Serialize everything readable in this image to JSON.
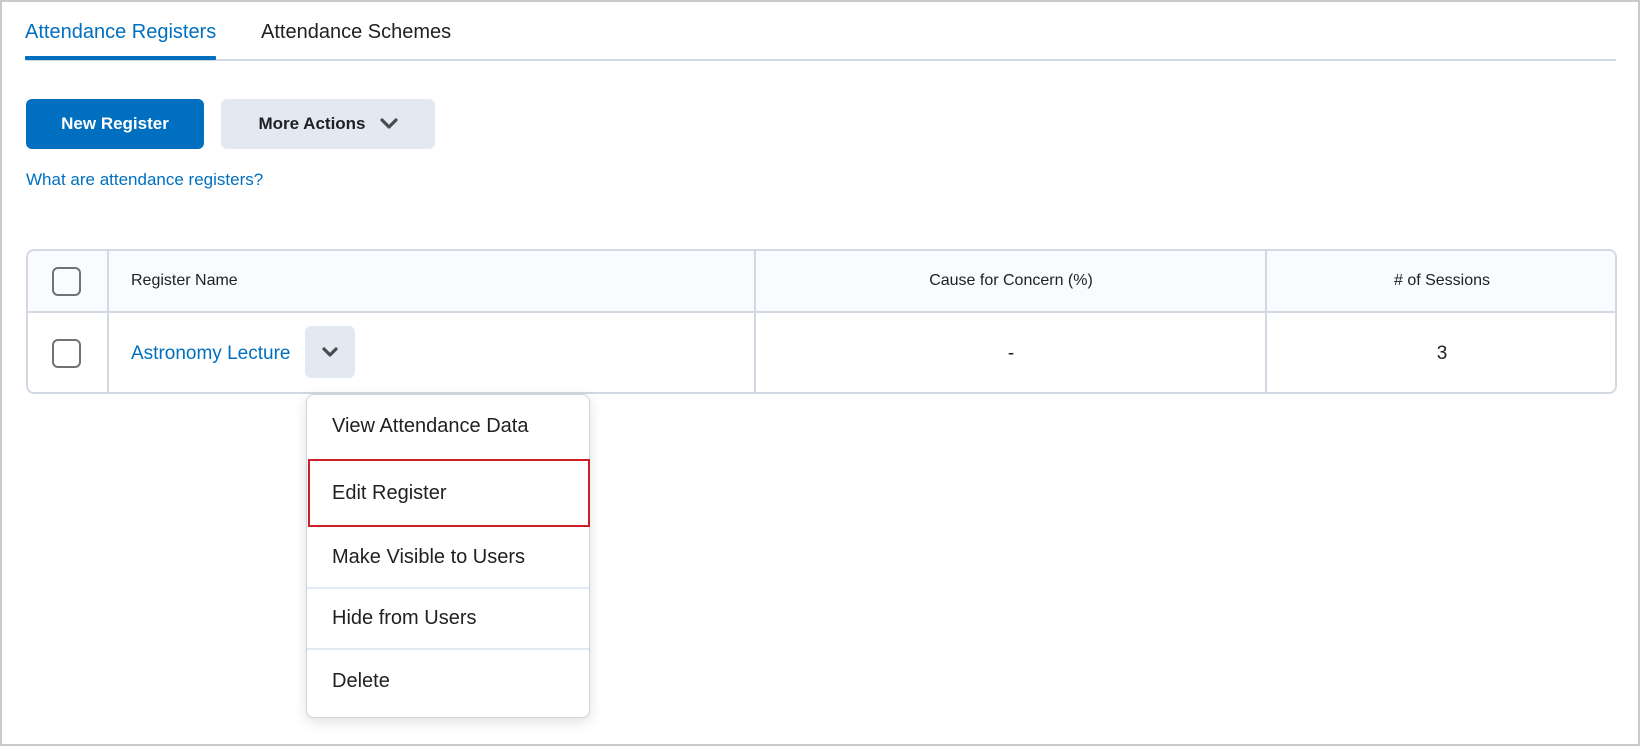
{
  "tabs": [
    {
      "label": "Attendance Registers",
      "active": true
    },
    {
      "label": "Attendance Schemes",
      "active": false
    }
  ],
  "toolbar": {
    "new_register_label": "New Register",
    "more_actions_label": "More Actions",
    "more_actions_icon": "chevron-down-icon"
  },
  "help_link": "What are attendance registers?",
  "table": {
    "columns": [
      "Register Name",
      "Cause for Concern (%)",
      "# of Sessions"
    ],
    "rows": [
      {
        "name": "Astronomy Lecture",
        "cause_for_concern": "-",
        "sessions": "3",
        "selected": false
      }
    ]
  },
  "context_menu": {
    "open_for_row": "Astronomy Lecture",
    "items": [
      {
        "label": "View Attendance Data"
      },
      {
        "label": "Edit Register",
        "highlighted": true
      },
      {
        "label": "Make Visible to Users"
      },
      {
        "label": "Hide from Users"
      },
      {
        "label": "Delete"
      }
    ]
  },
  "colors": {
    "accent": "#006fbf",
    "secondary_button": "#e3e9f1",
    "highlight_border": "#cd2026"
  }
}
